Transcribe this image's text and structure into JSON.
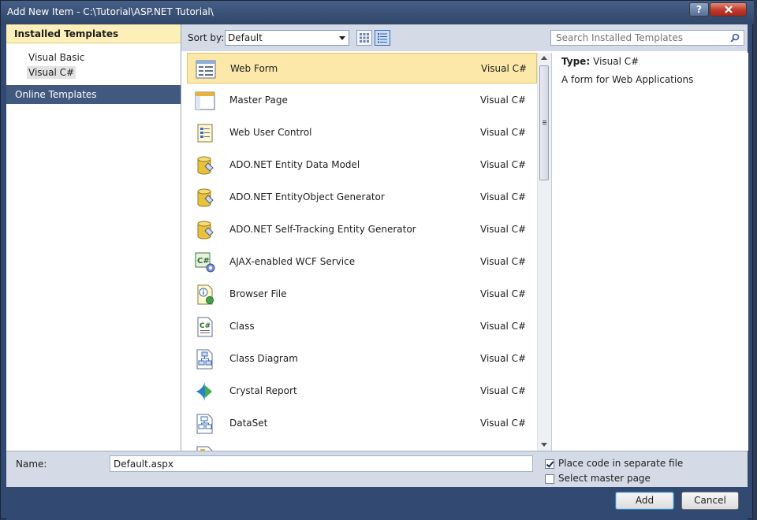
{
  "window": {
    "title": "Add New Item - C:\\Tutorial\\ASP.NET Tutorial\\",
    "help_label": "?",
    "close_label": "x"
  },
  "left": {
    "installed_header": "Installed Templates",
    "tree": [
      "Visual Basic",
      "Visual C#"
    ],
    "selected_tree_index": 1,
    "online_header": "Online Templates"
  },
  "toolbar": {
    "sort_label": "Sort by:",
    "sort_value": "Default",
    "search_placeholder": "Search Installed Templates"
  },
  "templates": [
    {
      "name": "Web Form",
      "lang": "Visual C#",
      "icon": "web-form-icon",
      "selected": true
    },
    {
      "name": "Master Page",
      "lang": "Visual C#",
      "icon": "master-page-icon"
    },
    {
      "name": "Web User Control",
      "lang": "Visual C#",
      "icon": "web-user-control-icon"
    },
    {
      "name": "ADO.NET Entity Data Model",
      "lang": "Visual C#",
      "icon": "database-icon"
    },
    {
      "name": "ADO.NET EntityObject Generator",
      "lang": "Visual C#",
      "icon": "database-icon"
    },
    {
      "name": "ADO.NET Self-Tracking Entity Generator",
      "lang": "Visual C#",
      "icon": "database-icon"
    },
    {
      "name": "AJAX-enabled WCF Service",
      "lang": "Visual C#",
      "icon": "wcf-service-icon"
    },
    {
      "name": "Browser File",
      "lang": "Visual C#",
      "icon": "browser-file-icon"
    },
    {
      "name": "Class",
      "lang": "Visual C#",
      "icon": "class-file-icon"
    },
    {
      "name": "Class Diagram",
      "lang": "Visual C#",
      "icon": "class-diagram-icon"
    },
    {
      "name": "Crystal Report",
      "lang": "Visual C#",
      "icon": "crystal-report-icon"
    },
    {
      "name": "DataSet",
      "lang": "Visual C#",
      "icon": "dataset-icon"
    }
  ],
  "details": {
    "type_label": "Type:",
    "type_value": "Visual C#",
    "description": "A form for Web Applications"
  },
  "bottom": {
    "name_label": "Name:",
    "name_value": "Default.aspx",
    "place_code_label": "Place code in separate file",
    "place_code_checked": true,
    "master_page_label": "Select master page",
    "master_page_checked": false
  },
  "buttons": {
    "add": "Add",
    "cancel": "Cancel"
  }
}
